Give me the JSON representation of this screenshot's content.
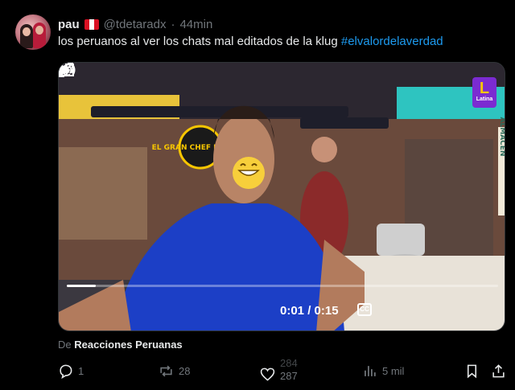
{
  "author": {
    "display_name": "pau",
    "flag_icon": "peru-flag-icon",
    "handle": "@tdetaradx",
    "separator": "·",
    "time": "44min"
  },
  "tweet": {
    "text": "los peruanos al ver los chats mal editados de la klug ",
    "hashtag": "#elvalordelaverdad"
  },
  "video": {
    "time_readout": "0:01 / 0:15",
    "progress": 0.067,
    "cc_label": "CC",
    "channel_logo": "L",
    "channel_logo_sub": "Latina",
    "set_logo": "EL GRAN CHEF Famosos",
    "side_sign": "ALMACEN"
  },
  "source": {
    "prefix": "De",
    "name": "Reacciones Peruanas"
  },
  "actions": {
    "replies": "1",
    "reposts": "28",
    "likes_previous": "284",
    "likes": "287",
    "views": "5 mil"
  },
  "colors": {
    "background": "#000000",
    "text": "#e7e9ea",
    "muted": "#71767b",
    "link": "#1d9bf0",
    "like_icon": "#e7e9ea"
  }
}
